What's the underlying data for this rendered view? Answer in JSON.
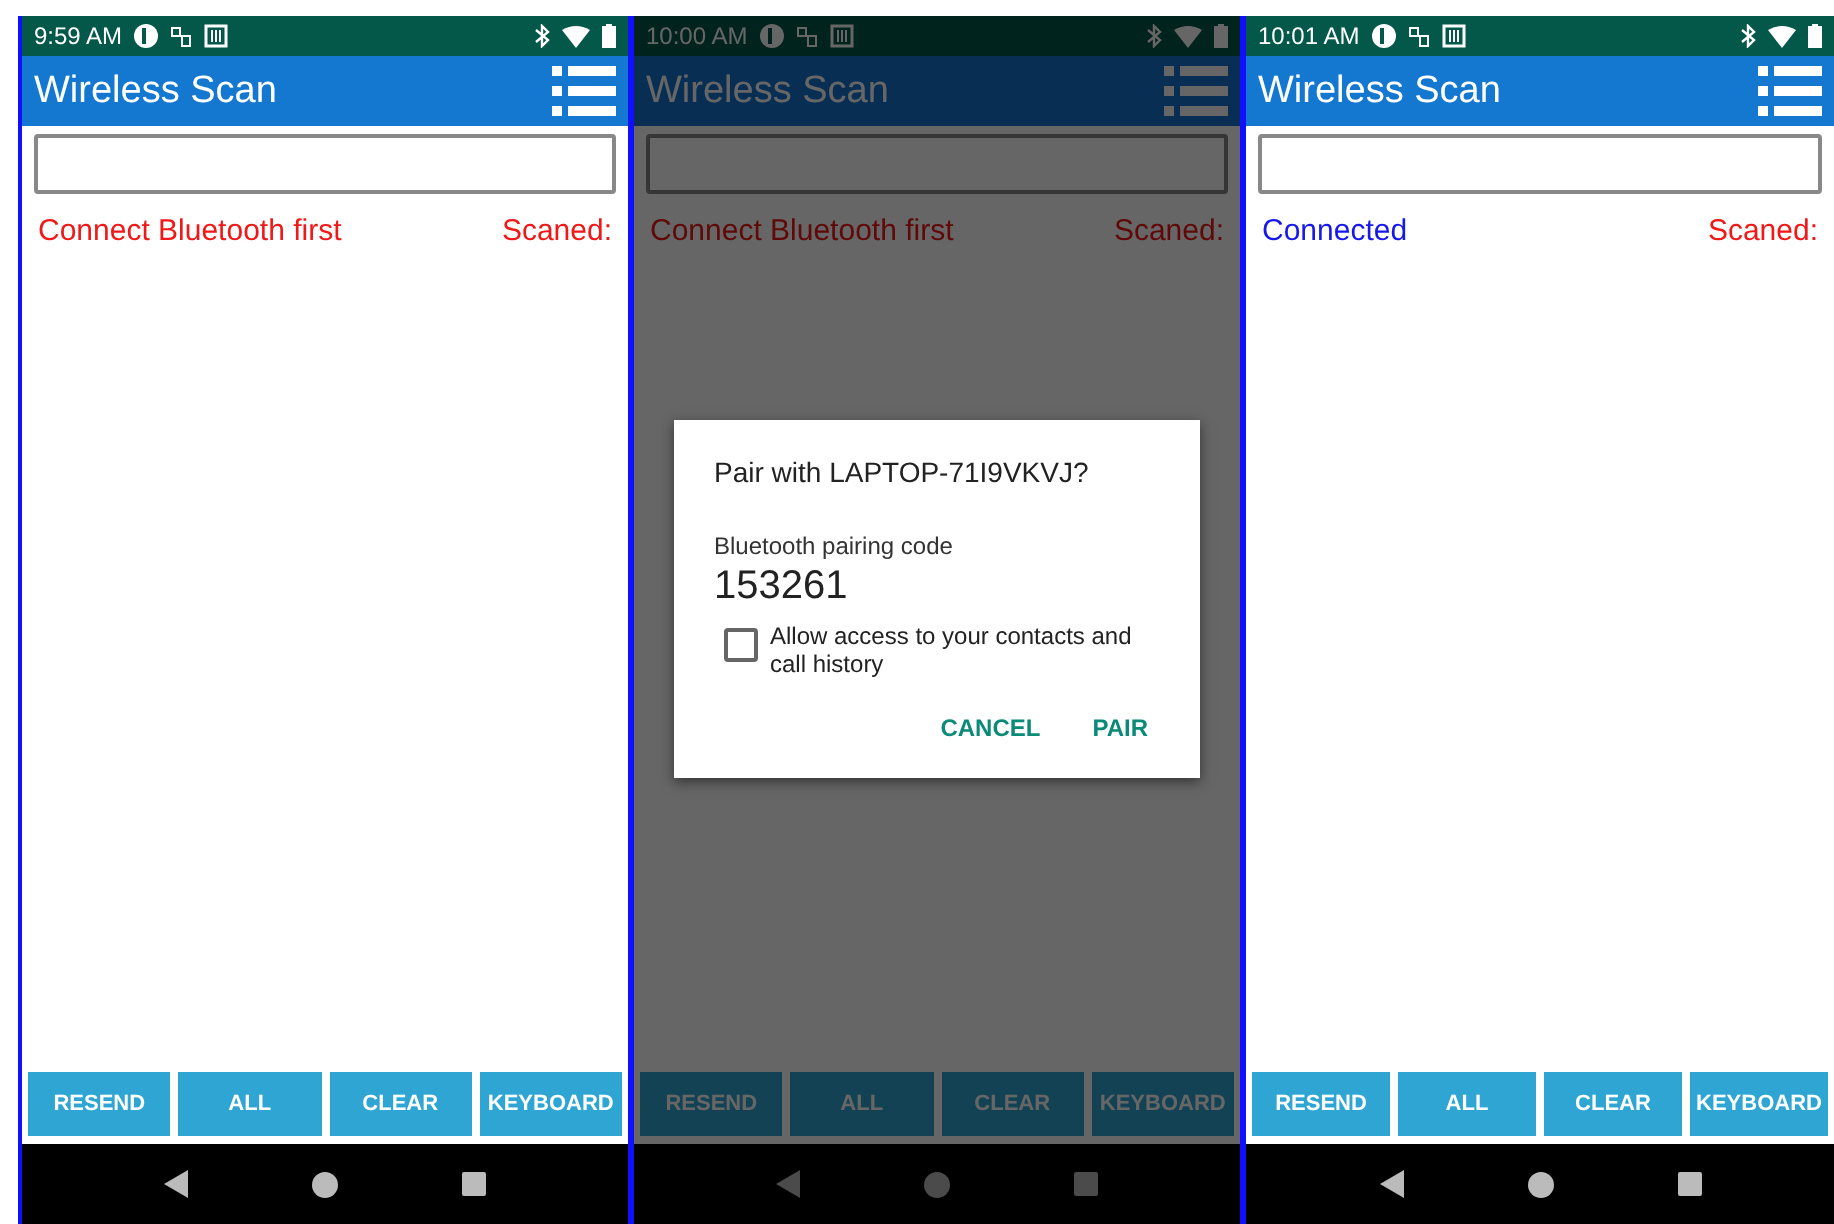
{
  "screens": [
    {
      "status_bar": {
        "time": "9:59 AM"
      },
      "app_bar": {
        "title": "Wireless Scan"
      },
      "connection": {
        "text": "Connect Bluetooth first",
        "connected": false
      },
      "scanned_label": "Scaned:",
      "buttons": [
        "RESEND",
        "ALL",
        "CLEAR",
        "KEYBOARD"
      ],
      "dimmed": false
    },
    {
      "status_bar": {
        "time": "10:00 AM"
      },
      "app_bar": {
        "title": "Wireless Scan"
      },
      "connection": {
        "text": "Connect Bluetooth first",
        "connected": false
      },
      "scanned_label": "Scaned:",
      "buttons": [
        "RESEND",
        "ALL",
        "CLEAR",
        "KEYBOARD"
      ],
      "dimmed": true,
      "dialog": {
        "title": "Pair with LAPTOP-71I9VKVJ?",
        "label": "Bluetooth pairing code",
        "code": "153261",
        "checkbox": {
          "label": "Allow access to your contacts and call history",
          "checked": false
        },
        "buttons": [
          "CANCEL",
          "PAIR"
        ]
      }
    },
    {
      "status_bar": {
        "time": "10:01 AM"
      },
      "app_bar": {
        "title": "Wireless Scan"
      },
      "connection": {
        "text": "Connected",
        "connected": true
      },
      "scanned_label": "Scaned:",
      "buttons": [
        "RESEND",
        "ALL",
        "CLEAR",
        "KEYBOARD"
      ],
      "dimmed": false
    }
  ]
}
